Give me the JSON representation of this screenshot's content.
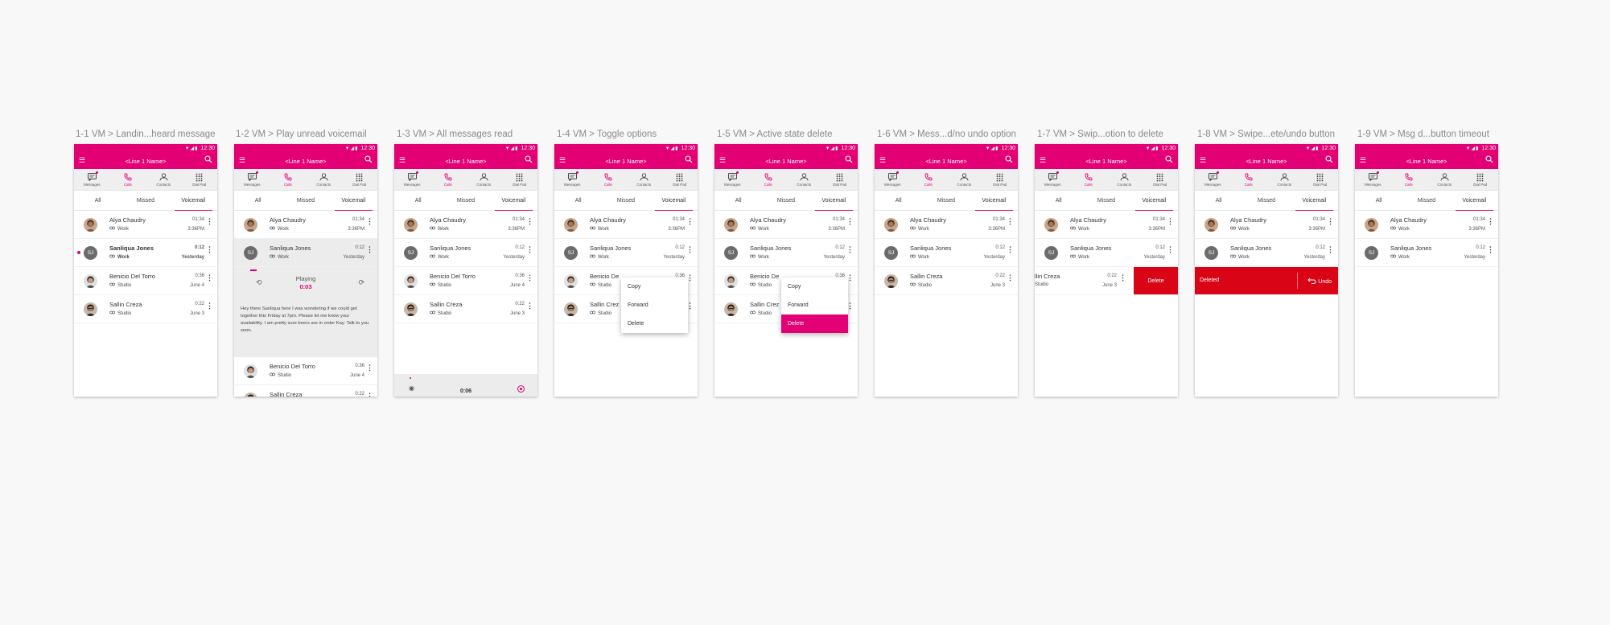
{
  "app": {
    "status_time": "12:30",
    "line_name": "<Line 1 Name>",
    "nav": [
      "Messages",
      "Calls",
      "Contacts",
      "Dial Pad"
    ],
    "tabs": [
      "All",
      "Missed",
      "Voicemail"
    ],
    "accent_color": "#e20074",
    "delete_color": "#d90517"
  },
  "contacts": {
    "alya": {
      "name": "Alya Chaudry",
      "type": "Work",
      "duration": "01:34",
      "when": "3:36PM"
    },
    "sanliqua": {
      "name": "Sanliqua Jones",
      "initials": "SJ",
      "type": "Work",
      "duration": "0:12",
      "when": "Yesterday"
    },
    "benicio": {
      "name": "Benicio Del Torro",
      "type": "Studio",
      "duration": "0:36",
      "when": "June 4"
    },
    "sallin": {
      "name": "Sallin Creza",
      "type": "Studio",
      "duration": "0:22",
      "when": "June 3"
    }
  },
  "frames": [
    {
      "label": "1-1 VM > Landin...heard message"
    },
    {
      "label": "1-2 VM > Play unread voicemail"
    },
    {
      "label": "1-3 VM > All messages read"
    },
    {
      "label": "1-4 VM > Toggle options"
    },
    {
      "label": "1-5 VM > Active state delete"
    },
    {
      "label": "1-6 VM > Mess...d/no undo option"
    },
    {
      "label": "1-7 VM > Swip...otion to delete"
    },
    {
      "label": "1-8 VM > Swipe...ete/undo button"
    },
    {
      "label": "1-9 VM > Msg d...button timeout"
    }
  ],
  "player": {
    "status": "Playing",
    "time": "0:03",
    "transcript": "Hey there Sanliqua here I was wondering if we could get together this Friday at 7pm.  Please let me know your availability.  I am pretty sure beers are in order Kay.  Talk to you soon.",
    "bottom_time": "0:06"
  },
  "context_menu": [
    "Copy",
    "Forward",
    "Delete"
  ],
  "swipe": {
    "partial_name": "llin Creza",
    "delete_label": "Delete",
    "deleted_label": "Deleted",
    "undo_label": "Undo"
  },
  "truncated": {
    "benicio": "Benicio De",
    "sallin": "Sallin Crez"
  }
}
